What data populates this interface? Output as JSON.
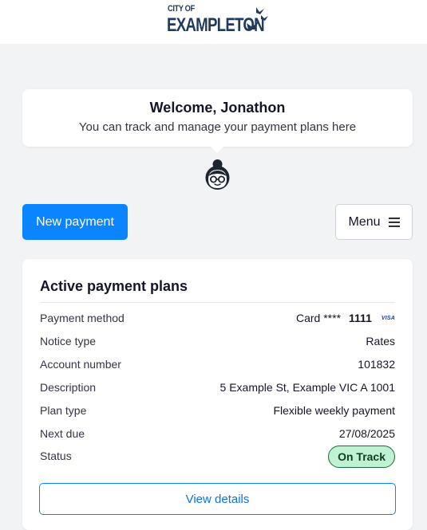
{
  "header": {
    "logo_line1": "CITY OF",
    "logo_line2": "EXAMPLETON"
  },
  "welcome": {
    "title": "Welcome, Jonathon",
    "subtitle": "You can track and manage your payment plans here"
  },
  "actions": {
    "new_payment_label": "New payment",
    "menu_label": "Menu"
  },
  "plans": {
    "title": "Active payment plans",
    "rows": {
      "payment_method": {
        "label": "Payment method",
        "card_prefix": "Card ****",
        "card_last4": "1111",
        "card_brand": "VISA"
      },
      "notice_type": {
        "label": "Notice type",
        "value": "Rates"
      },
      "account_number": {
        "label": "Account number",
        "value": "101832"
      },
      "description": {
        "label": "Description",
        "value": "5 Example St, Example VIC A 1001"
      },
      "plan_type": {
        "label": "Plan type",
        "value": "Flexible weekly payment"
      },
      "next_due": {
        "label": "Next due",
        "value": "27/08/2025"
      },
      "status": {
        "label": "Status",
        "value": "On Track"
      }
    },
    "view_details_label": "View details"
  },
  "colors": {
    "primary": "#0a84ff",
    "logo": "#1f3a5c",
    "status_bg": "#bff2d2",
    "status_border": "#1d6b3c"
  },
  "icons": {
    "menu": "hamburger-icon",
    "avatar": "assistant-avatar-icon",
    "logo_birds": "birds-icon"
  }
}
